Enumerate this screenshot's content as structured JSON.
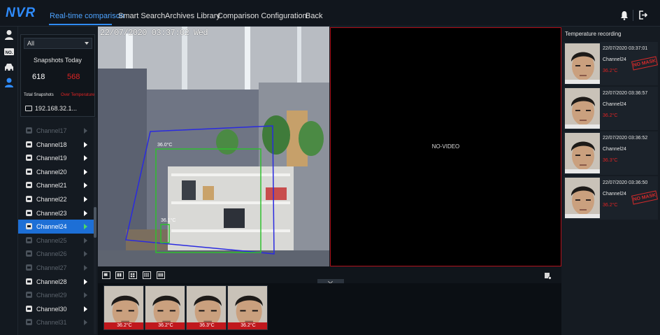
{
  "app": {
    "logo": "NVR"
  },
  "nav": {
    "items": [
      {
        "label": "Real-time comparison",
        "active": true
      },
      {
        "label": "Smart Search",
        "active": false
      },
      {
        "label": "Archives Library",
        "active": false
      },
      {
        "label": "Comparison Configuration",
        "active": false
      },
      {
        "label": "Back",
        "active": false
      }
    ]
  },
  "header_icons": [
    "bell-icon",
    "logout-icon"
  ],
  "rail_icons": [
    "person-icon",
    "number-plate-icon",
    "vehicle-icon",
    "face-temperature-icon"
  ],
  "snapshots": {
    "filter_value": "All",
    "title": "Snapshots Today",
    "total": "618",
    "over_temperature": "568",
    "total_label": "Total Snapshots",
    "over_label": "Over Temperature"
  },
  "device": {
    "label": "192.168.32.1..."
  },
  "channels": [
    {
      "label": "Channel17",
      "enabled": false,
      "selected": false
    },
    {
      "label": "Channel18",
      "enabled": true,
      "selected": false
    },
    {
      "label": "Channel19",
      "enabled": true,
      "selected": false
    },
    {
      "label": "Channel20",
      "enabled": true,
      "selected": false
    },
    {
      "label": "Channel21",
      "enabled": true,
      "selected": false
    },
    {
      "label": "Channel22",
      "enabled": true,
      "selected": false
    },
    {
      "label": "Channel23",
      "enabled": true,
      "selected": false
    },
    {
      "label": "Channel24",
      "enabled": true,
      "selected": true
    },
    {
      "label": "Channel25",
      "enabled": false,
      "selected": false
    },
    {
      "label": "Channel26",
      "enabled": false,
      "selected": false
    },
    {
      "label": "Channel27",
      "enabled": false,
      "selected": false
    },
    {
      "label": "Channel28",
      "enabled": true,
      "selected": false
    },
    {
      "label": "Channel29",
      "enabled": false,
      "selected": false
    },
    {
      "label": "Channel30",
      "enabled": true,
      "selected": false
    },
    {
      "label": "Channel31",
      "enabled": false,
      "selected": false
    }
  ],
  "live_view": {
    "osd_timestamp": "22/07/2020 03:37:02 Wed",
    "box_labels": [
      "36.0°C",
      "36.1°C"
    ],
    "second_pane": "NO-VIDEO"
  },
  "layouts": [
    "layout-1-icon",
    "layout-4-icon",
    "layout-6-icon",
    "layout-9-icon",
    "layout-16-icon"
  ],
  "strip": [
    {
      "temp": "36.2°C"
    },
    {
      "temp": "36.2°C"
    },
    {
      "temp": "36.3°C"
    },
    {
      "temp": "36.2°C"
    }
  ],
  "temperature_panel": {
    "title": "Temperature recording",
    "records": [
      {
        "time": "22/07/2020 03:37:01",
        "channel": "Channel24",
        "temp": "36.2°C",
        "stamp": "NO MASK"
      },
      {
        "time": "22/07/2020 03:36:57",
        "channel": "Channel24",
        "temp": "36.2°C",
        "stamp": ""
      },
      {
        "time": "22/07/2020 03:36:52",
        "channel": "Channel24",
        "temp": "36.3°C",
        "stamp": ""
      },
      {
        "time": "22/07/2020 03:36:50",
        "channel": "Channel24",
        "temp": "36.2°C",
        "stamp": "NO MASK"
      }
    ]
  },
  "colors": {
    "accent": "#2f8cff",
    "selected": "#1d6fd6",
    "alert": "#e02424"
  }
}
